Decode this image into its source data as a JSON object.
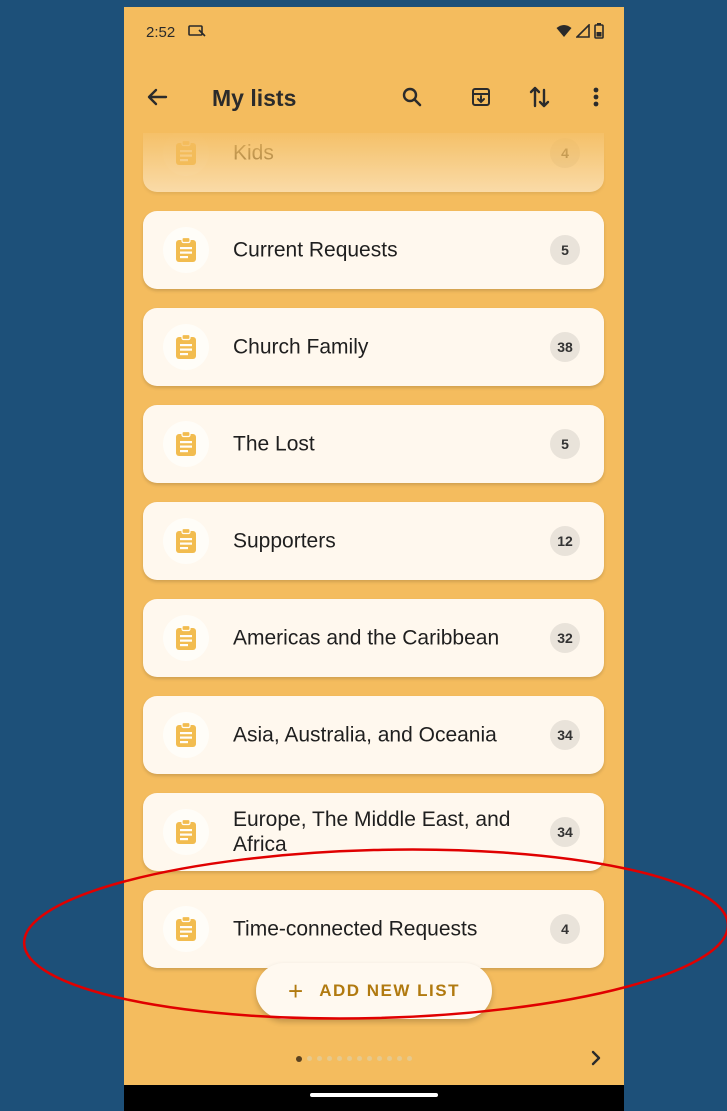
{
  "status_bar": {
    "time": "2:52"
  },
  "app_bar": {
    "title": "My lists"
  },
  "lists": [
    {
      "name": "Kids",
      "count": "4"
    },
    {
      "name": "Current Requests",
      "count": "5"
    },
    {
      "name": "Church Family",
      "count": "38"
    },
    {
      "name": "The Lost",
      "count": "5"
    },
    {
      "name": "Supporters",
      "count": "12"
    },
    {
      "name": "Americas and the Caribbean",
      "count": "32"
    },
    {
      "name": "Asia, Australia, and Oceania",
      "count": "34"
    },
    {
      "name": "Europe, The Middle East, and Africa",
      "count": "34"
    },
    {
      "name": "Time-connected Requests",
      "count": "4"
    }
  ],
  "fab": {
    "icon": "+",
    "label": "ADD NEW LIST"
  },
  "pager": {
    "pages": 12,
    "current": 1
  },
  "icons": {
    "back": "arrow-left-icon",
    "search": "search-icon",
    "archive": "archive-icon",
    "sort": "sort-icon",
    "more": "more-vert-icon",
    "list": "clipboard-icon"
  },
  "colors": {
    "background": "#f4bc5e",
    "card": "#fff8ee",
    "accent": "#b17a10",
    "annotation": "#e00000"
  }
}
